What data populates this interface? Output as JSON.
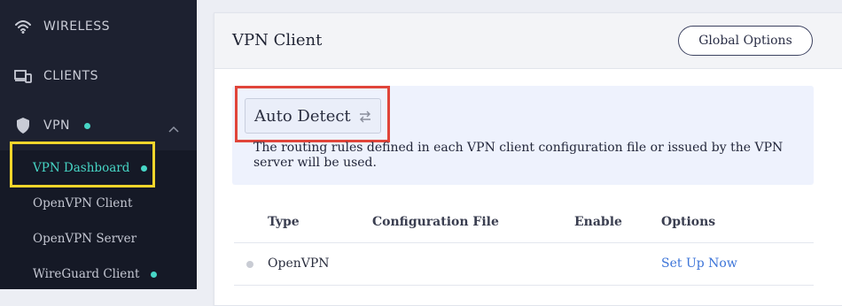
{
  "sidebar": {
    "items": [
      {
        "label": "WIRELESS",
        "icon": "wifi-icon"
      },
      {
        "label": "CLIENTS",
        "icon": "devices-icon"
      },
      {
        "label": "VPN",
        "icon": "shield-icon",
        "status": "active",
        "expanded": true
      }
    ],
    "vpn_submenu": [
      {
        "label": "VPN Dashboard",
        "active": true,
        "status_dot": true
      },
      {
        "label": "OpenVPN Client",
        "active": false,
        "status_dot": false
      },
      {
        "label": "OpenVPN Server",
        "active": false,
        "status_dot": false
      },
      {
        "label": "WireGuard Client",
        "active": false,
        "status_dot": true
      }
    ]
  },
  "card": {
    "title": "VPN Client",
    "global_options_label": "Global Options",
    "mode": {
      "label": "Auto Detect",
      "icon": "swap-arrows-icon",
      "description": "The routing rules defined in each VPN client configuration file or issued by the VPN server will be used."
    },
    "table": {
      "headers": [
        "Type",
        "Configuration File",
        "Enable",
        "Options"
      ],
      "rows": [
        {
          "type": "OpenVPN",
          "configuration_file": "",
          "enable": "",
          "options": "Set Up Now",
          "status": "inactive"
        }
      ]
    }
  },
  "colors": {
    "accent": "#47d6c6",
    "sidebar_bg": "#1d2130",
    "link": "#3c74d8",
    "highlight_red": "#e0453a",
    "highlight_yellow": "#f1d52b"
  }
}
